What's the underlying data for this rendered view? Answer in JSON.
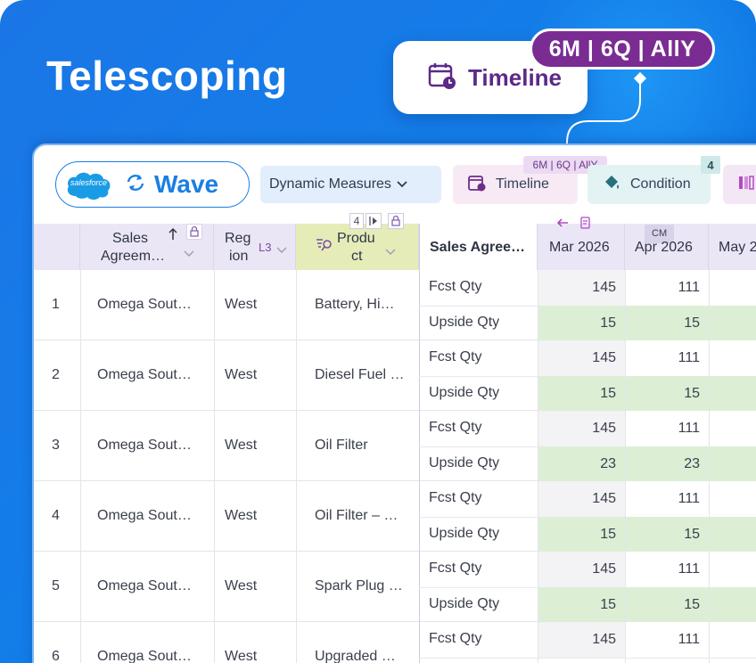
{
  "hero_title": "Telescoping",
  "callout": {
    "label": "Timeline",
    "pill": "6M | 6Q | AllY"
  },
  "toolbar": {
    "brand_small": "salesforce",
    "brand": "Wave",
    "dropdown_label": "Dynamic Measures",
    "timeline_label": "Timeline",
    "timeline_pill": "6M | 6Q | AllY",
    "condition_label": "Condition",
    "condition_badge": "4"
  },
  "headers": {
    "sales_agreement": "Sales Agreem…",
    "sales_agreement_line1": "Sales",
    "sales_agreement_line2": "Agreem…",
    "region_line1": "Reg",
    "region_line2": "ion",
    "region_level": "L3",
    "product_line1": "Produ",
    "product_line2": "ct",
    "product_badge": "4",
    "measure": "Sales Agree…",
    "col1": "Mar 2026",
    "col2_tag": "CM",
    "col2": "Apr 2026",
    "col3": "May 2"
  },
  "rows": [
    {
      "index": "1",
      "agreement": "Omega Sout…",
      "region": "West",
      "product": "Battery, Hi…",
      "m1": "Fcst Qty",
      "m1_v1": "145",
      "m1_v2": "111",
      "m2": "Upside Qty",
      "m2_v1": "15",
      "m2_v2": "15"
    },
    {
      "index": "2",
      "agreement": "Omega Sout…",
      "region": "West",
      "product": "Diesel Fuel …",
      "m1": "Fcst Qty",
      "m1_v1": "145",
      "m1_v2": "111",
      "m2": "Upside Qty",
      "m2_v1": "15",
      "m2_v2": "15"
    },
    {
      "index": "3",
      "agreement": "Omega Sout…",
      "region": "West",
      "product": "Oil Filter",
      "m1": "Fcst Qty",
      "m1_v1": "145",
      "m1_v2": "111",
      "m2": "Upside Qty",
      "m2_v1": "23",
      "m2_v2": "23"
    },
    {
      "index": "4",
      "agreement": "Omega Sout…",
      "region": "West",
      "product": "Oil Filter – …",
      "m1": "Fcst Qty",
      "m1_v1": "145",
      "m1_v2": "111",
      "m2": "Upside Qty",
      "m2_v1": "15",
      "m2_v2": "15"
    },
    {
      "index": "5",
      "agreement": "Omega Sout…",
      "region": "West",
      "product": "Spark Plug …",
      "m1": "Fcst Qty",
      "m1_v1": "145",
      "m1_v2": "111",
      "m2": "Upside Qty",
      "m2_v1": "15",
      "m2_v2": "15"
    },
    {
      "index": "6",
      "agreement": "Omega Sout…",
      "region": "West",
      "product": "Upgraded …",
      "m1": "Fcst Qty",
      "m1_v1": "145",
      "m1_v2": "111",
      "m2": "",
      "m2_v1": "",
      "m2_v2": ""
    }
  ],
  "icons": [
    "calendar-icon",
    "refresh-icon",
    "chevron-down-icon",
    "paint-bucket-icon",
    "lock-icon",
    "sort-up-icon",
    "filter-search-icon",
    "arrow-left-icon",
    "document-icon"
  ],
  "colors": {
    "brand_blue": "#1a7fe3",
    "accent_purple": "#7a2c93",
    "upside_green": "#dcefd5",
    "header_bg": "#ebe6f5"
  }
}
